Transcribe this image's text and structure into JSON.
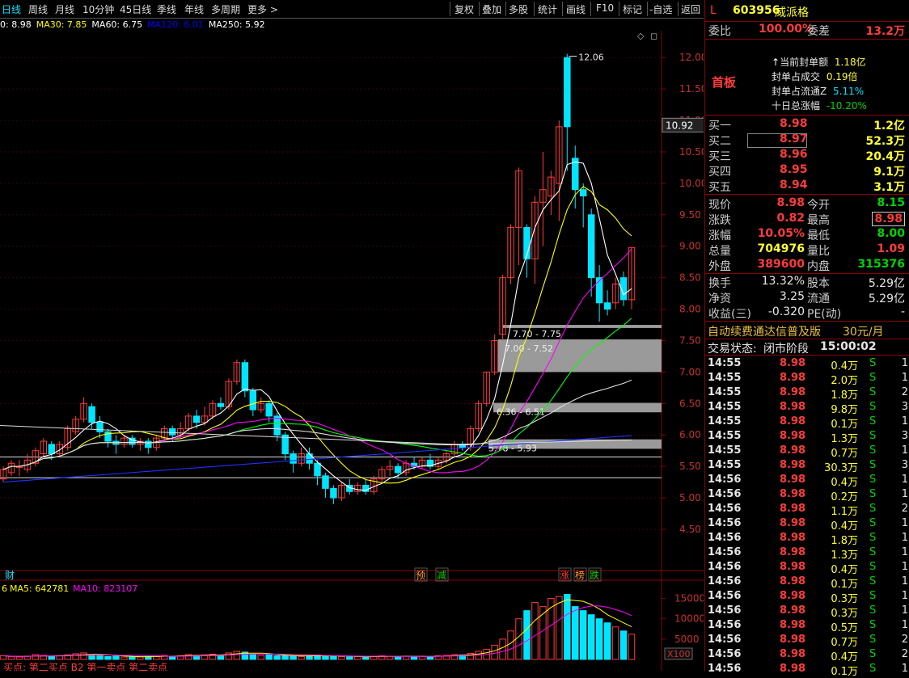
{
  "toolbar": {
    "periods": [
      "日线",
      "周线",
      "月线",
      "10分钟",
      "45日线",
      "季线",
      "年线",
      "多周期",
      "更多 >"
    ],
    "active_period": "日线",
    "tools": [
      "复权",
      "叠加",
      "多股",
      "统计",
      "画线",
      "F10",
      "标记",
      "-自选",
      "返回"
    ]
  },
  "ma_legend": [
    {
      "label": "0: 8.98",
      "color": "#ffffff"
    },
    {
      "label": "MA30: 7.85",
      "color": "#ffff00"
    },
    {
      "label": "MA60: 6.75",
      "color": "#ffffff"
    },
    {
      "label": "MA120: 6.01",
      "color": "#0000ff"
    },
    {
      "label": "MA250: 5.92",
      "color": "#ffffff"
    }
  ],
  "price_axis": [
    "12.00",
    "11.50",
    "11.00",
    "10.50",
    "10.00",
    "9.50",
    "9.00",
    "8.50",
    "8.00",
    "7.50",
    "7.00",
    "6.50",
    "6.00",
    "5.50",
    "5.00",
    "4.50"
  ],
  "current_price_tag": "10.92",
  "annotations": {
    "high_label": "12.06",
    "zones": [
      "7.70 - 7.75",
      "7.00 - 7.52",
      "6.36 - 6.51",
      "5.78 - 5.93"
    ],
    "markers_left": "财",
    "markers": [
      {
        "text": "预",
        "color": "#ff9933"
      },
      {
        "text": "减",
        "color": "#00d400"
      },
      {
        "text": "涨",
        "color": "#ff3c3c"
      },
      {
        "text": "榜",
        "color": "#ff9933"
      },
      {
        "text": "跌",
        "color": "#00d400"
      }
    ]
  },
  "volume_legend": [
    {
      "label": "6",
      "color": "#ffff00"
    },
    {
      "label": "MA5: 642781",
      "color": "#ffff00"
    },
    {
      "label": "MA10: 823107",
      "color": "#ff00ff"
    }
  ],
  "volume_axis": [
    "15000",
    "10000",
    "5000"
  ],
  "volume_unit": "X100",
  "bottom_tabs": "买点: 第二买点 B2 第一卖点 第二卖点",
  "stock": {
    "flag": "L",
    "code": "603956",
    "name": "威派格"
  },
  "committee": {
    "ratio_label": "委比",
    "ratio": "100.00%",
    "diff_label": "委差",
    "diff": "13.2万"
  },
  "seal": {
    "badge": "首板",
    "rows": [
      {
        "label": "当前封单额",
        "value": "1.18亿",
        "color": "#ffff33"
      },
      {
        "label": "封单占成交",
        "value": "0.19倍",
        "color": "#ffff33"
      },
      {
        "label": "封单占流通Z",
        "value": "5.11%",
        "color": "#00e5ff"
      },
      {
        "label": "十日总涨幅",
        "value": "-10.20%",
        "color": "#00d400"
      }
    ]
  },
  "bids": [
    {
      "label": "买一",
      "price": "8.98",
      "vol": "1.2亿"
    },
    {
      "label": "买二",
      "price": "8.97",
      "vol": "52.3万"
    },
    {
      "label": "买三",
      "price": "8.96",
      "vol": "20.4万"
    },
    {
      "label": "买四",
      "price": "8.95",
      "vol": "9.1万"
    },
    {
      "label": "买五",
      "price": "8.94",
      "vol": "3.1万"
    }
  ],
  "quote": [
    {
      "l1": "现价",
      "v1": "8.98",
      "c1": "#ff3c3c",
      "l2": "今开",
      "v2": "8.15",
      "c2": "#00d400"
    },
    {
      "l1": "涨跌",
      "v1": "0.82",
      "c1": "#ff3c3c",
      "l2": "最高",
      "v2": "8.98",
      "c2": "#ff3c3c"
    },
    {
      "l1": "涨幅",
      "v1": "10.05%",
      "c1": "#ff3c3c",
      "l2": "最低",
      "v2": "8.00",
      "c2": "#00d400"
    },
    {
      "l1": "总量",
      "v1": "704976",
      "c1": "#ffff33",
      "l2": "量比",
      "v2": "1.09",
      "c2": "#ff3c3c"
    },
    {
      "l1": "外盘",
      "v1": "389600",
      "c1": "#ff3c3c",
      "l2": "内盘",
      "v2": "315376",
      "c2": "#00d400"
    }
  ],
  "fundamentals": [
    {
      "l1": "换手",
      "v1": "13.32%",
      "l2": "股本",
      "v2": "5.29亿"
    },
    {
      "l1": "净资",
      "v1": "3.25",
      "l2": "流通",
      "v2": "5.29亿"
    },
    {
      "l1": "收益(三)",
      "v1": "-0.320",
      "l2": "PE(动)",
      "v2": "-"
    }
  ],
  "promo": {
    "text": "自动续费通达信普及版",
    "price": "30元/月"
  },
  "trade_status": {
    "label": "交易状态:",
    "state": "闭市阶段",
    "time": "15:00:02"
  },
  "ticks": [
    {
      "t": "14:55",
      "p": "8.98",
      "v": "0.4万",
      "s": "S",
      "n": "1"
    },
    {
      "t": "14:55",
      "p": "8.98",
      "v": "2.0万",
      "s": "S",
      "n": "1"
    },
    {
      "t": "14:55",
      "p": "8.98",
      "v": "1.8万",
      "s": "S",
      "n": "2"
    },
    {
      "t": "14:55",
      "p": "8.98",
      "v": "9.8万",
      "s": "S",
      "n": "3"
    },
    {
      "t": "14:55",
      "p": "8.98",
      "v": "0.1万",
      "s": "S",
      "n": "1"
    },
    {
      "t": "14:55",
      "p": "8.98",
      "v": "1.3万",
      "s": "S",
      "n": "3"
    },
    {
      "t": "14:55",
      "p": "8.98",
      "v": "0.7万",
      "s": "S",
      "n": "1"
    },
    {
      "t": "14:55",
      "p": "8.98",
      "v": "30.3万",
      "s": "S",
      "n": "3"
    },
    {
      "t": "14:56",
      "p": "8.98",
      "v": "0.4万",
      "s": "S",
      "n": "1"
    },
    {
      "t": "14:56",
      "p": "8.98",
      "v": "0.2万",
      "s": "S",
      "n": "1"
    },
    {
      "t": "14:56",
      "p": "8.98",
      "v": "1.1万",
      "s": "S",
      "n": "2"
    },
    {
      "t": "14:56",
      "p": "8.98",
      "v": "0.4万",
      "s": "S",
      "n": "1"
    },
    {
      "t": "14:56",
      "p": "8.98",
      "v": "1.8万",
      "s": "S",
      "n": "1"
    },
    {
      "t": "14:56",
      "p": "8.98",
      "v": "1.3万",
      "s": "S",
      "n": "1"
    },
    {
      "t": "14:56",
      "p": "8.98",
      "v": "0.4万",
      "s": "S",
      "n": "1"
    },
    {
      "t": "14:56",
      "p": "8.98",
      "v": "0.1万",
      "s": "S",
      "n": "1"
    },
    {
      "t": "14:56",
      "p": "8.98",
      "v": "0.3万",
      "s": "S",
      "n": "1"
    },
    {
      "t": "14:56",
      "p": "8.98",
      "v": "0.3万",
      "s": "S",
      "n": "1"
    },
    {
      "t": "14:56",
      "p": "8.98",
      "v": "0.5万",
      "s": "S",
      "n": "1"
    },
    {
      "t": "14:56",
      "p": "8.98",
      "v": "0.7万",
      "s": "S",
      "n": "2"
    },
    {
      "t": "14:56",
      "p": "8.98",
      "v": "0.4万",
      "s": "S",
      "n": "2"
    },
    {
      "t": "14:56",
      "p": "8.98",
      "v": "0.1万",
      "s": "S",
      "n": "1"
    }
  ],
  "colors": {
    "up": "#ff3c3c",
    "down": "#00e5ff",
    "grid": "#8b0000",
    "panel_bg": "#000000"
  },
  "candles": [
    [
      5.3,
      5.45,
      5.25,
      5.5
    ],
    [
      5.4,
      5.55,
      5.35,
      5.6
    ],
    [
      5.5,
      5.5,
      5.35,
      5.6
    ],
    [
      5.45,
      5.6,
      5.4,
      5.7
    ],
    [
      5.55,
      5.75,
      5.5,
      5.8
    ],
    [
      5.7,
      5.9,
      5.65,
      5.95
    ],
    [
      5.85,
      5.7,
      5.6,
      5.9
    ],
    [
      5.7,
      5.85,
      5.65,
      5.9
    ],
    [
      5.8,
      6.1,
      5.75,
      6.15
    ],
    [
      6.05,
      6.25,
      6.0,
      6.3
    ],
    [
      6.25,
      6.5,
      6.2,
      6.6
    ],
    [
      6.45,
      6.2,
      6.1,
      6.5
    ],
    [
      6.2,
      6.05,
      5.95,
      6.3
    ],
    [
      6.05,
      5.9,
      5.8,
      6.1
    ],
    [
      5.9,
      5.85,
      5.7,
      6.0
    ],
    [
      5.85,
      5.95,
      5.8,
      6.0
    ],
    [
      5.95,
      5.85,
      5.8,
      6.0
    ],
    [
      5.85,
      5.9,
      5.75,
      5.95
    ],
    [
      5.9,
      5.8,
      5.7,
      5.95
    ],
    [
      5.8,
      5.95,
      5.75,
      6.0
    ],
    [
      5.95,
      6.1,
      5.9,
      6.15
    ],
    [
      6.1,
      6.0,
      5.9,
      6.15
    ],
    [
      6.0,
      6.1,
      5.95,
      6.2
    ],
    [
      6.1,
      6.3,
      6.05,
      6.35
    ],
    [
      6.3,
      6.2,
      6.1,
      6.4
    ],
    [
      6.2,
      6.3,
      6.15,
      6.45
    ],
    [
      6.3,
      6.5,
      6.25,
      6.55
    ],
    [
      6.5,
      6.45,
      6.4,
      6.6
    ],
    [
      6.45,
      6.85,
      6.4,
      6.9
    ],
    [
      6.85,
      7.15,
      6.8,
      7.2
    ],
    [
      7.15,
      6.7,
      6.6,
      7.2
    ],
    [
      6.7,
      6.4,
      6.3,
      6.75
    ],
    [
      6.4,
      6.5,
      6.35,
      6.6
    ],
    [
      6.5,
      6.3,
      6.2,
      6.55
    ],
    [
      6.3,
      6.0,
      5.9,
      6.35
    ],
    [
      6.0,
      5.7,
      5.6,
      6.05
    ],
    [
      5.7,
      5.55,
      5.4,
      5.75
    ],
    [
      5.55,
      5.7,
      5.5,
      5.8
    ],
    [
      5.7,
      5.55,
      5.45,
      5.8
    ],
    [
      5.55,
      5.35,
      5.2,
      5.6
    ],
    [
      5.35,
      5.15,
      5.0,
      5.4
    ],
    [
      5.15,
      5.0,
      4.9,
      5.2
    ],
    [
      5.0,
      5.2,
      4.95,
      5.25
    ],
    [
      5.2,
      5.1,
      5.05,
      5.3
    ],
    [
      5.1,
      5.2,
      5.05,
      5.25
    ],
    [
      5.2,
      5.1,
      5.05,
      5.3
    ],
    [
      5.1,
      5.3,
      5.05,
      5.35
    ],
    [
      5.3,
      5.45,
      5.25,
      5.5
    ],
    [
      5.45,
      5.5,
      5.35,
      5.6
    ],
    [
      5.5,
      5.4,
      5.3,
      5.55
    ],
    [
      5.4,
      5.55,
      5.35,
      5.6
    ],
    [
      5.55,
      5.5,
      5.45,
      5.65
    ],
    [
      5.5,
      5.6,
      5.45,
      5.65
    ],
    [
      5.6,
      5.5,
      5.45,
      5.7
    ],
    [
      5.5,
      5.6,
      5.45,
      5.65
    ],
    [
      5.6,
      5.7,
      5.55,
      5.75
    ],
    [
      5.7,
      5.85,
      5.65,
      5.9
    ],
    [
      5.85,
      5.8,
      5.75,
      5.9
    ],
    [
      5.8,
      6.1,
      5.75,
      6.15
    ],
    [
      6.1,
      6.5,
      6.05,
      6.55
    ],
    [
      6.5,
      7.0,
      6.45,
      7.0
    ],
    [
      7.0,
      7.5,
      6.95,
      7.6
    ],
    [
      7.6,
      8.5,
      7.5,
      8.55
    ],
    [
      8.5,
      9.3,
      8.4,
      9.35
    ],
    [
      9.3,
      10.2,
      8.7,
      10.25
    ],
    [
      9.3,
      8.8,
      8.5,
      9.35
    ],
    [
      8.8,
      9.7,
      8.4,
      9.8
    ],
    [
      9.7,
      9.9,
      9.0,
      10.5
    ],
    [
      9.8,
      10.1,
      9.5,
      10.2
    ],
    [
      10.0,
      10.9,
      9.4,
      11.0
    ],
    [
      12.0,
      10.9,
      10.2,
      12.06
    ],
    [
      10.4,
      9.9,
      9.6,
      10.6
    ],
    [
      9.9,
      9.8,
      9.3,
      10.0
    ],
    [
      9.5,
      8.5,
      8.2,
      9.6
    ],
    [
      8.5,
      8.1,
      7.8,
      8.7
    ],
    [
      8.1,
      8.0,
      7.9,
      8.3
    ],
    [
      8.1,
      8.4,
      8.0,
      8.5
    ],
    [
      8.5,
      8.15,
      8.05,
      8.6
    ],
    [
      8.15,
      8.98,
      8.0,
      8.98
    ]
  ],
  "volumes": [
    900,
    700,
    600,
    800,
    1200,
    1000,
    700,
    900,
    1100,
    1400,
    1600,
    1200,
    900,
    700,
    800,
    600,
    700,
    600,
    700,
    900,
    1000,
    800,
    900,
    1200,
    1000,
    1100,
    1300,
    1000,
    1600,
    2000,
    1800,
    1300,
    1000,
    1100,
    900,
    1000,
    800,
    700,
    900,
    1100,
    900,
    800,
    700,
    600,
    700,
    600,
    800,
    900,
    800,
    700,
    800,
    700,
    800,
    700,
    900,
    1000,
    1200,
    1100,
    1500,
    2000,
    2500,
    3500,
    5000,
    7000,
    10000,
    12000,
    14000,
    13000,
    15000,
    15500,
    16000,
    13000,
    12000,
    11000,
    10000,
    9000,
    8000,
    7000,
    6200
  ]
}
